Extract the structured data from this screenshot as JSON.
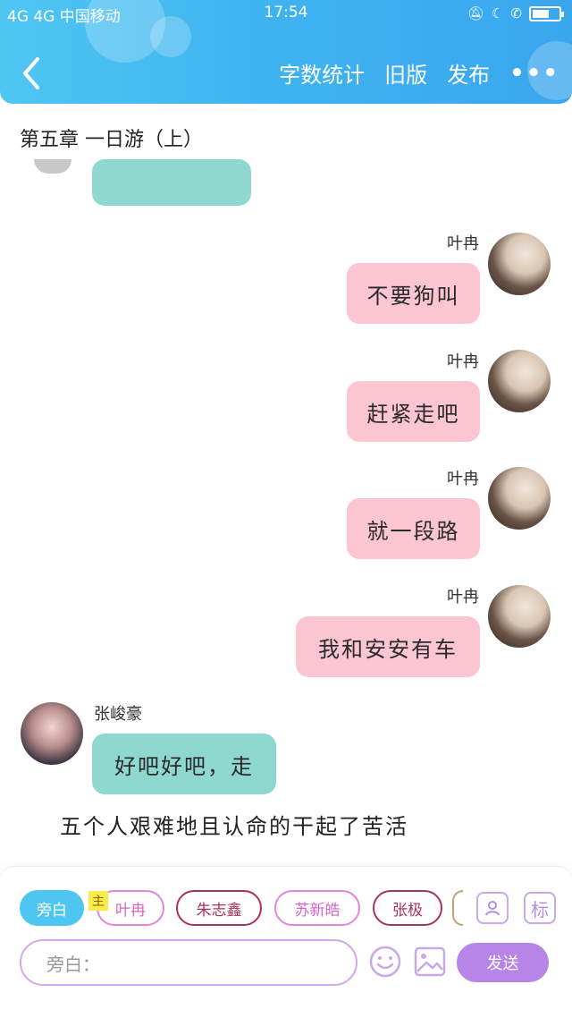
{
  "status_bar": {
    "carrier": "4G 4G 中国移动",
    "time": "17:54",
    "icons": [
      "mute-icon",
      "moon-icon",
      "hd-call-icon",
      "battery-icon"
    ]
  },
  "header": {
    "back_icon": "chevron-left-icon",
    "actions": [
      "字数统计",
      "旧版",
      "发布"
    ],
    "more_label": "•••"
  },
  "chapter_title": "第五章 一日游（上）",
  "messages": [
    {
      "side": "right",
      "name": "叶冉",
      "text": "不要狗叫"
    },
    {
      "side": "right",
      "name": "叶冉",
      "text": "赶紧走吧"
    },
    {
      "side": "right",
      "name": "叶冉",
      "text": "就一段路"
    },
    {
      "side": "right",
      "name": "叶冉",
      "text": "我和安安有车"
    },
    {
      "side": "left",
      "name": "张峻豪",
      "text": "好吧好吧，走"
    }
  ],
  "narration": "五个人艰难地且认命的干起了苦活",
  "composer": {
    "role_chips": [
      {
        "label": "旁白",
        "active": true
      },
      {
        "label": "叶冉",
        "active": false,
        "host": true
      },
      {
        "label": "朱志鑫",
        "active": false
      },
      {
        "label": "苏新皓",
        "active": false
      },
      {
        "label": "张极",
        "active": false
      }
    ],
    "host_tag": "主",
    "manage_icon": "person-card-icon",
    "tag_icon_label": "标",
    "input_placeholder": "旁白：",
    "emoji_icon": "smile-icon",
    "image_icon": "image-icon",
    "send_label": "发送"
  },
  "colors": {
    "header": "#3fb4f0",
    "right_bubble": "#fbc6d2",
    "left_bubble": "#8fd8cf",
    "send_button": "#b784e8",
    "active_chip": "#4fc6f2"
  }
}
